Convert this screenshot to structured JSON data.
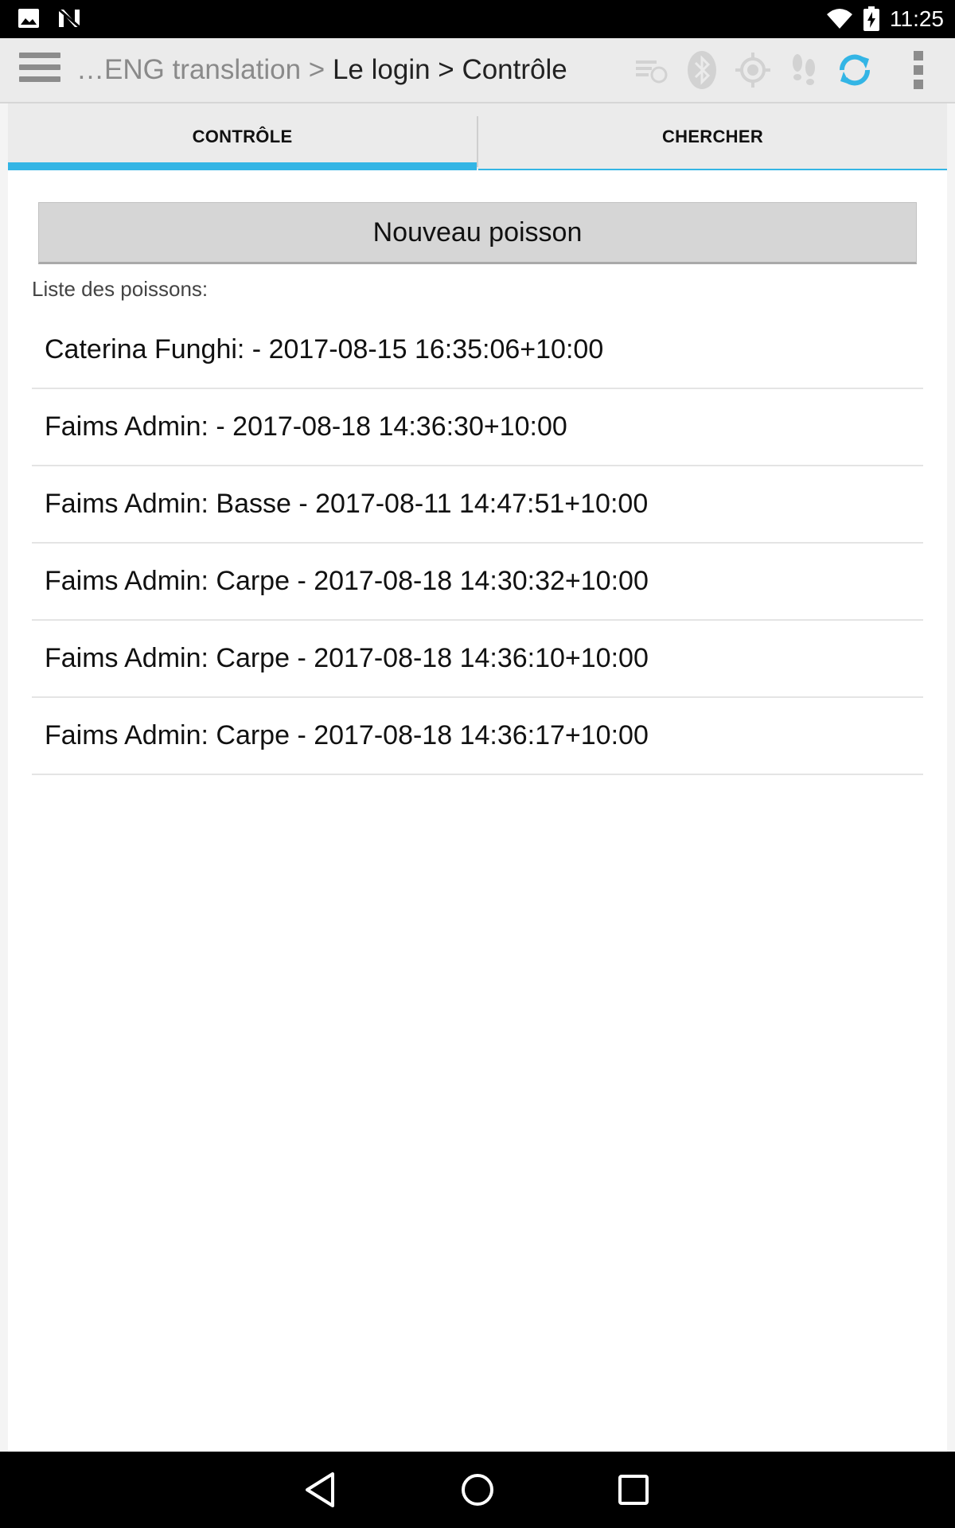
{
  "status_bar": {
    "time": "11:25",
    "icons": [
      "image-notification-icon",
      "n-notification-icon",
      "wifi-icon",
      "battery-charging-icon"
    ]
  },
  "action_bar": {
    "breadcrumb_muted": "…ENG translation > ",
    "breadcrumb_main": "Le login > Contrôle",
    "icons": [
      "menu-icon",
      "sync-list-icon",
      "bluetooth-icon",
      "gps-icon",
      "footprints-icon",
      "sync-icon",
      "overflow-menu-icon"
    ],
    "accent_color": "#33b5e5"
  },
  "tabs": [
    {
      "label": "CONTRÔLE",
      "active": true
    },
    {
      "label": "CHERCHER",
      "active": false
    }
  ],
  "main": {
    "new_button_label": "Nouveau poisson",
    "list_label": "Liste des poissons:",
    "items": [
      "Caterina Funghi:  - 2017-08-15 16:35:06+10:00",
      "Faims Admin:  - 2017-08-18 14:36:30+10:00",
      "Faims Admin: Basse - 2017-08-11 14:47:51+10:00",
      "Faims Admin: Carpe - 2017-08-18 14:30:32+10:00",
      "Faims Admin: Carpe - 2017-08-18 14:36:10+10:00",
      "Faims Admin: Carpe - 2017-08-18 14:36:17+10:00"
    ]
  },
  "nav_bar": {
    "icons": [
      "back-icon",
      "home-icon",
      "recents-icon"
    ]
  }
}
